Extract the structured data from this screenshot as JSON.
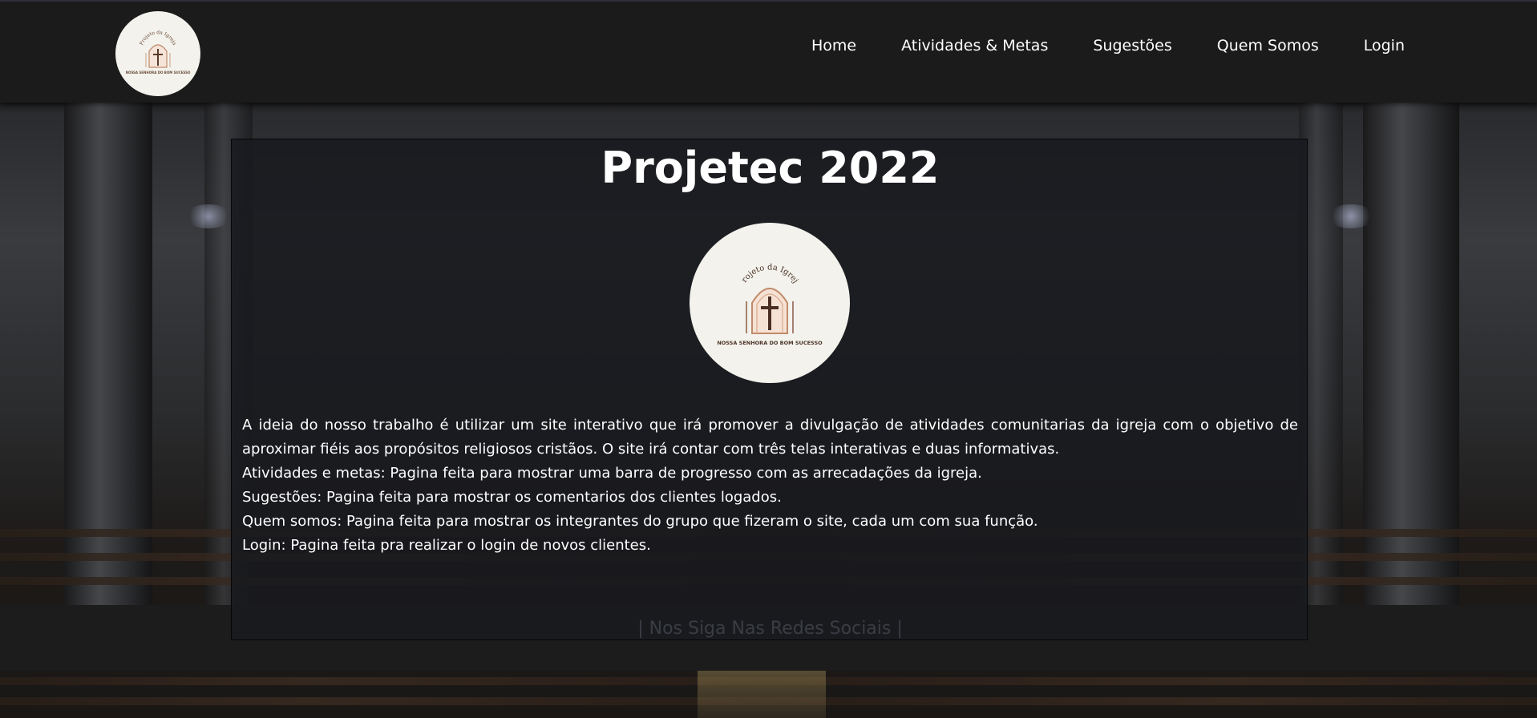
{
  "header": {
    "logo": {
      "icon": "church-window-cross-logo",
      "arc_text": "Projeto da Igreja",
      "sub_text": "NOSSA SENHORA DO BOM SUCESSO"
    },
    "nav": [
      {
        "label": "Home"
      },
      {
        "label": "Atividades & Metas"
      },
      {
        "label": "Sugestões"
      },
      {
        "label": "Quem Somos"
      },
      {
        "label": "Login"
      }
    ]
  },
  "main": {
    "title": "Projetec 2022",
    "logo": {
      "icon": "church-window-cross-logo",
      "arc_text": "Projeto da Igreja",
      "sub_text": "NOSSA SENHORA DO BOM SUCESSO"
    },
    "paragraphs": [
      "A ideia do nosso trabalho é utilizar um site interativo que irá promover a divulgação de atividades comunitarias da igreja com o objetivo de aproximar fiéis aos propósitos religiosos cristãos. O site irá contar com três telas interativas e duas informativas.",
      "Atividades e metas: Pagina feita para mostrar uma barra de progresso com as arrecadações da igreja.",
      "Sugestões: Pagina feita para mostrar os comentarios dos clientes logados.",
      "Quem somos: Pagina feita para mostrar os integrantes do grupo que fizeram o site, cada um com sua função.",
      "Login: Pagina feita pra realizar o login de novos clientes."
    ]
  },
  "footer": {
    "social_text": "| Nos Siga Nas Redes Sociais |"
  },
  "colors": {
    "header_bg": "#1b1b1c",
    "card_bg": "#181a1e",
    "logo_bg": "#f3f2ec",
    "logo_accent": "#c08a6a",
    "text": "#ffffff"
  }
}
